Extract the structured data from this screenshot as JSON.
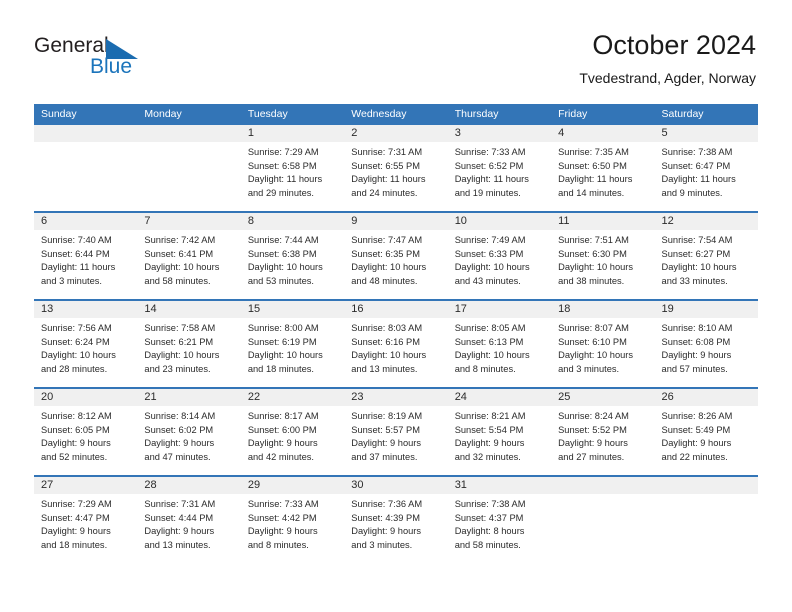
{
  "logo": {
    "word_one": "General",
    "word_two": "Blue",
    "triangle_color": "#1b6cb0",
    "blue_text_color": "#1b74bb"
  },
  "header": {
    "title": "October 2024",
    "subtitle": "Tvedestrand, Agder, Norway"
  },
  "theme": {
    "header_blue": "#3375b7",
    "date_band_gray": "#f0f0f0",
    "text_dark": "#2b2b2b"
  },
  "weekdays": [
    "Sunday",
    "Monday",
    "Tuesday",
    "Wednesday",
    "Thursday",
    "Friday",
    "Saturday"
  ],
  "weeks": [
    [
      {
        "day": "",
        "lines": []
      },
      {
        "day": "",
        "lines": []
      },
      {
        "day": "1",
        "lines": [
          "Sunrise: 7:29 AM",
          "Sunset: 6:58 PM",
          "Daylight: 11 hours",
          "and 29 minutes."
        ]
      },
      {
        "day": "2",
        "lines": [
          "Sunrise: 7:31 AM",
          "Sunset: 6:55 PM",
          "Daylight: 11 hours",
          "and 24 minutes."
        ]
      },
      {
        "day": "3",
        "lines": [
          "Sunrise: 7:33 AM",
          "Sunset: 6:52 PM",
          "Daylight: 11 hours",
          "and 19 minutes."
        ]
      },
      {
        "day": "4",
        "lines": [
          "Sunrise: 7:35 AM",
          "Sunset: 6:50 PM",
          "Daylight: 11 hours",
          "and 14 minutes."
        ]
      },
      {
        "day": "5",
        "lines": [
          "Sunrise: 7:38 AM",
          "Sunset: 6:47 PM",
          "Daylight: 11 hours",
          "and 9 minutes."
        ]
      }
    ],
    [
      {
        "day": "6",
        "lines": [
          "Sunrise: 7:40 AM",
          "Sunset: 6:44 PM",
          "Daylight: 11 hours",
          "and 3 minutes."
        ]
      },
      {
        "day": "7",
        "lines": [
          "Sunrise: 7:42 AM",
          "Sunset: 6:41 PM",
          "Daylight: 10 hours",
          "and 58 minutes."
        ]
      },
      {
        "day": "8",
        "lines": [
          "Sunrise: 7:44 AM",
          "Sunset: 6:38 PM",
          "Daylight: 10 hours",
          "and 53 minutes."
        ]
      },
      {
        "day": "9",
        "lines": [
          "Sunrise: 7:47 AM",
          "Sunset: 6:35 PM",
          "Daylight: 10 hours",
          "and 48 minutes."
        ]
      },
      {
        "day": "10",
        "lines": [
          "Sunrise: 7:49 AM",
          "Sunset: 6:33 PM",
          "Daylight: 10 hours",
          "and 43 minutes."
        ]
      },
      {
        "day": "11",
        "lines": [
          "Sunrise: 7:51 AM",
          "Sunset: 6:30 PM",
          "Daylight: 10 hours",
          "and 38 minutes."
        ]
      },
      {
        "day": "12",
        "lines": [
          "Sunrise: 7:54 AM",
          "Sunset: 6:27 PM",
          "Daylight: 10 hours",
          "and 33 minutes."
        ]
      }
    ],
    [
      {
        "day": "13",
        "lines": [
          "Sunrise: 7:56 AM",
          "Sunset: 6:24 PM",
          "Daylight: 10 hours",
          "and 28 minutes."
        ]
      },
      {
        "day": "14",
        "lines": [
          "Sunrise: 7:58 AM",
          "Sunset: 6:21 PM",
          "Daylight: 10 hours",
          "and 23 minutes."
        ]
      },
      {
        "day": "15",
        "lines": [
          "Sunrise: 8:00 AM",
          "Sunset: 6:19 PM",
          "Daylight: 10 hours",
          "and 18 minutes."
        ]
      },
      {
        "day": "16",
        "lines": [
          "Sunrise: 8:03 AM",
          "Sunset: 6:16 PM",
          "Daylight: 10 hours",
          "and 13 minutes."
        ]
      },
      {
        "day": "17",
        "lines": [
          "Sunrise: 8:05 AM",
          "Sunset: 6:13 PM",
          "Daylight: 10 hours",
          "and 8 minutes."
        ]
      },
      {
        "day": "18",
        "lines": [
          "Sunrise: 8:07 AM",
          "Sunset: 6:10 PM",
          "Daylight: 10 hours",
          "and 3 minutes."
        ]
      },
      {
        "day": "19",
        "lines": [
          "Sunrise: 8:10 AM",
          "Sunset: 6:08 PM",
          "Daylight: 9 hours",
          "and 57 minutes."
        ]
      }
    ],
    [
      {
        "day": "20",
        "lines": [
          "Sunrise: 8:12 AM",
          "Sunset: 6:05 PM",
          "Daylight: 9 hours",
          "and 52 minutes."
        ]
      },
      {
        "day": "21",
        "lines": [
          "Sunrise: 8:14 AM",
          "Sunset: 6:02 PM",
          "Daylight: 9 hours",
          "and 47 minutes."
        ]
      },
      {
        "day": "22",
        "lines": [
          "Sunrise: 8:17 AM",
          "Sunset: 6:00 PM",
          "Daylight: 9 hours",
          "and 42 minutes."
        ]
      },
      {
        "day": "23",
        "lines": [
          "Sunrise: 8:19 AM",
          "Sunset: 5:57 PM",
          "Daylight: 9 hours",
          "and 37 minutes."
        ]
      },
      {
        "day": "24",
        "lines": [
          "Sunrise: 8:21 AM",
          "Sunset: 5:54 PM",
          "Daylight: 9 hours",
          "and 32 minutes."
        ]
      },
      {
        "day": "25",
        "lines": [
          "Sunrise: 8:24 AM",
          "Sunset: 5:52 PM",
          "Daylight: 9 hours",
          "and 27 minutes."
        ]
      },
      {
        "day": "26",
        "lines": [
          "Sunrise: 8:26 AM",
          "Sunset: 5:49 PM",
          "Daylight: 9 hours",
          "and 22 minutes."
        ]
      }
    ],
    [
      {
        "day": "27",
        "lines": [
          "Sunrise: 7:29 AM",
          "Sunset: 4:47 PM",
          "Daylight: 9 hours",
          "and 18 minutes."
        ]
      },
      {
        "day": "28",
        "lines": [
          "Sunrise: 7:31 AM",
          "Sunset: 4:44 PM",
          "Daylight: 9 hours",
          "and 13 minutes."
        ]
      },
      {
        "day": "29",
        "lines": [
          "Sunrise: 7:33 AM",
          "Sunset: 4:42 PM",
          "Daylight: 9 hours",
          "and 8 minutes."
        ]
      },
      {
        "day": "30",
        "lines": [
          "Sunrise: 7:36 AM",
          "Sunset: 4:39 PM",
          "Daylight: 9 hours",
          "and 3 minutes."
        ]
      },
      {
        "day": "31",
        "lines": [
          "Sunrise: 7:38 AM",
          "Sunset: 4:37 PM",
          "Daylight: 8 hours",
          "and 58 minutes."
        ]
      },
      {
        "day": "",
        "lines": []
      },
      {
        "day": "",
        "lines": []
      }
    ]
  ]
}
